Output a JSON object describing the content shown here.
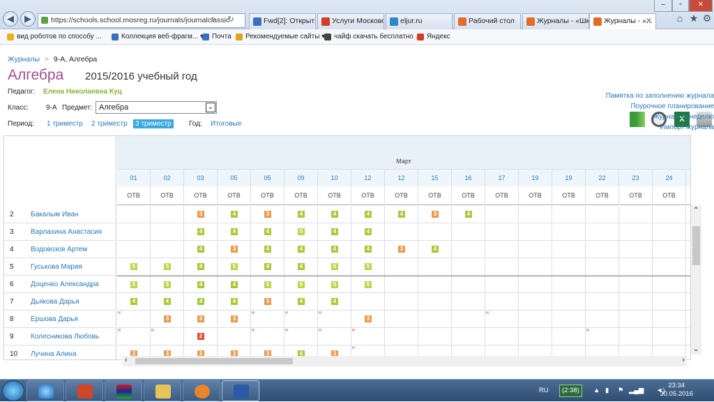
{
  "browser": {
    "url": "https://schools.school.mosreg.ru/journals/journalclassic",
    "tabs": [
      {
        "label": "Fwd[2]: Открыты...",
        "active": false
      },
      {
        "label": "Услуги Московс...",
        "active": false
      },
      {
        "label": "eljur.ru",
        "active": false
      },
      {
        "label": "Рабочий стол",
        "active": false
      },
      {
        "label": "Журналы - «Шк...",
        "active": false
      },
      {
        "label": "Журналы - «...",
        "active": true
      }
    ],
    "favorites": [
      "вид роботов по способу ...",
      "Коллекция веб-фрагм... ▾",
      "Почта",
      "Рекомендуемые сайты ▾",
      "чайф скачать бесплатно ...",
      "Яндекс"
    ]
  },
  "breadcrumb": {
    "root": "Журналы",
    "sep": ">",
    "current": "9-А, Алгебра"
  },
  "header": {
    "subject": "Алгебра",
    "year": "2015/2016 учебный год"
  },
  "teacher": {
    "label": "Педагог:",
    "name": "Елена Николаевна Куц"
  },
  "filters": {
    "class_label": "Класс:",
    "class_value": "9-А",
    "subject_label": "Предмет:",
    "subject_value": "Алгебра",
    "period_label": "Период:",
    "periods": [
      "1 триместр",
      "2 триместр",
      "3 триместр"
    ],
    "active_period": "3 триместр",
    "year_label": "Год:",
    "year_value": "Итоговые"
  },
  "right_links": [
    "Памятка по заполнению журнала",
    "Поурочное планирование",
    "Журнал за неделю",
    "Импорт журнала"
  ],
  "grid": {
    "month": "Март",
    "days": [
      "01",
      "02",
      "03",
      "05",
      "05",
      "09",
      "10",
      "12",
      "12",
      "15",
      "16",
      "17",
      "19",
      "19",
      "22",
      "23",
      "24"
    ],
    "col_type": "ОТВ",
    "students": [
      {
        "n": "2",
        "name": "Бакалым Иван",
        "marks": [
          "",
          "",
          "3",
          "4",
          "3",
          "4",
          "4",
          "4",
          "4",
          "3",
          "4",
          "",
          "",
          "",
          "",
          "",
          ""
        ]
      },
      {
        "n": "3",
        "name": "Варлахина Анастасия",
        "marks": [
          "",
          "",
          "4",
          "4",
          "4",
          "5",
          "4",
          "4",
          "",
          "",
          "",
          "",
          "",
          "",
          "",
          "",
          ""
        ]
      },
      {
        "n": "4",
        "name": "Водовозов Артем",
        "marks": [
          "",
          "",
          "4",
          "3",
          "4",
          "4",
          "4",
          "4",
          "3",
          "4",
          "",
          "",
          "",
          "",
          "",
          "",
          ""
        ]
      },
      {
        "n": "5",
        "name": "Гуськова Мария",
        "marks": [
          "5",
          "5",
          "4",
          "5",
          "4",
          "4",
          "5",
          "5",
          "",
          "",
          "",
          "",
          "",
          "",
          "",
          "",
          ""
        ]
      },
      {
        "n": "6",
        "name": "Доценко Александра",
        "marks": [
          "5",
          "5",
          "4",
          "4",
          "5",
          "5",
          "5",
          "5",
          "",
          "",
          "",
          "",
          "",
          "",
          "",
          "",
          ""
        ]
      },
      {
        "n": "7",
        "name": "Дьякова Дарья",
        "marks": [
          "4",
          "4",
          "4",
          "4",
          "3",
          "4",
          "4",
          "",
          "",
          "",
          "",
          "",
          "",
          "",
          "",
          "",
          ""
        ]
      },
      {
        "n": "8",
        "name": "Ершова Дарья",
        "marks": [
          "н",
          "3",
          "3",
          "3",
          "н",
          "н",
          "н",
          "3",
          "",
          "",
          "",
          "н",
          "",
          "",
          "",
          "",
          ""
        ]
      },
      {
        "n": "9",
        "name": "Колесникова Любовь",
        "marks": [
          "н",
          "н",
          "2",
          "",
          "н",
          "н",
          "н",
          "н",
          "",
          "",
          "",
          "",
          "",
          "",
          "н",
          "",
          ""
        ]
      },
      {
        "n": "10",
        "name": "Лучина Алина",
        "marks": [
          "3",
          "3",
          "3",
          "3",
          "3",
          "4",
          "3",
          "н",
          "",
          "",
          "",
          "",
          "",
          "",
          "",
          "",
          ""
        ]
      }
    ]
  },
  "taskbar": {
    "lang": "RU",
    "battery": "(2:38)",
    "time": "23:34",
    "date": "30.05.2016"
  },
  "colors": {
    "title": "#a04c92",
    "link": "#2a78b7",
    "teacher": "#8bb23a",
    "active_period_bg": "#3aa8dd"
  }
}
